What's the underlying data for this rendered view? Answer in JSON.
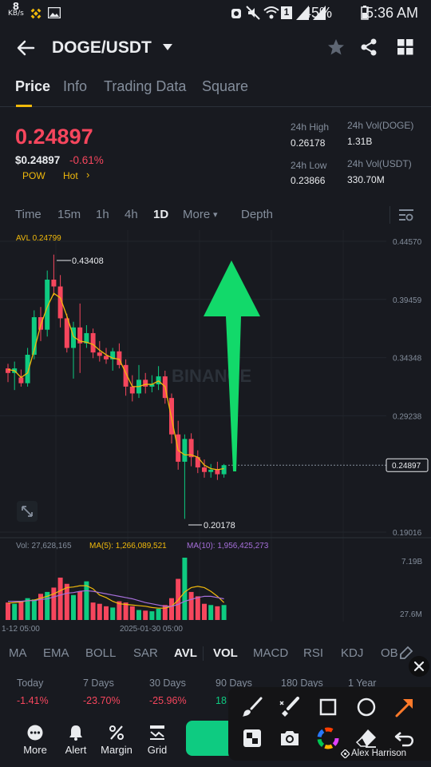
{
  "status_bar": {
    "net_speed": "8",
    "net_unit": "KB/s",
    "battery": "45%",
    "time": "5:36 AM",
    "sim_badge": "1"
  },
  "header": {
    "pair": "DOGE/USDT",
    "back_icon": "arrow-left-icon",
    "star_icon": "star-icon",
    "share_icon": "share-icon",
    "grid_icon": "grid-icon"
  },
  "tabs": [
    {
      "label": "Price",
      "active": true
    },
    {
      "label": "Info"
    },
    {
      "label": "Trading Data"
    },
    {
      "label": "Square"
    }
  ],
  "price": {
    "last": "0.24897",
    "usd": "$0.24897",
    "change": "-0.61%",
    "tag_pow": "POW",
    "tag_hot": "Hot",
    "tag_arrow": "›"
  },
  "stats": {
    "high_label": "24h High",
    "high_value": "0.26178",
    "low_label": "24h Low",
    "low_value": "0.23866",
    "vol_base_label": "24h Vol(DOGE)",
    "vol_base_value": "1.31B",
    "vol_quote_label": "24h Vol(USDT)",
    "vol_quote_value": "330.70M"
  },
  "intervals": {
    "items": [
      "Time",
      "15m",
      "1h",
      "4h",
      "1D",
      "More"
    ],
    "active": "1D",
    "more_caret": "▾",
    "depth_label": "Depth"
  },
  "chart": {
    "avl_label": "AVL 0.24799",
    "watermark": "BINANCE",
    "price_axis": [
      "0.44570",
      "0.39459",
      "0.34348",
      "0.29238",
      "0.24897",
      "0.19016"
    ],
    "max_label": "0.43408",
    "min_label": "0.20178",
    "vol_label": "Vol: 27,628,165",
    "ma5_label": "MA(5): 1,266,089,521",
    "ma10_label": "MA(10): 1,956,425,273",
    "vol_axis_top": "7.19B",
    "vol_axis_bottom": "27.6M",
    "date_left": "1-12 05:00",
    "date_center": "2025-01-30 05:00",
    "colors": {
      "up": "#0ecb81",
      "down": "#f6465d",
      "avl": "#f0b90b",
      "ma10": "#a66fda",
      "arrow": "#12d96a"
    }
  },
  "chart_data": {
    "type": "candlestick",
    "ylim": [
      0.19016,
      0.4457
    ],
    "candles": [
      {
        "o": 0.334,
        "h": 0.338,
        "l": 0.322,
        "c": 0.33
      },
      {
        "o": 0.33,
        "h": 0.34,
        "l": 0.315,
        "c": 0.334
      },
      {
        "o": 0.326,
        "h": 0.333,
        "l": 0.318,
        "c": 0.321
      },
      {
        "o": 0.321,
        "h": 0.352,
        "l": 0.318,
        "c": 0.346
      },
      {
        "o": 0.346,
        "h": 0.385,
        "l": 0.342,
        "c": 0.379
      },
      {
        "o": 0.379,
        "h": 0.388,
        "l": 0.358,
        "c": 0.368
      },
      {
        "o": 0.368,
        "h": 0.42,
        "l": 0.362,
        "c": 0.412
      },
      {
        "o": 0.412,
        "h": 0.434,
        "l": 0.398,
        "c": 0.406
      },
      {
        "o": 0.406,
        "h": 0.416,
        "l": 0.37,
        "c": 0.378
      },
      {
        "o": 0.378,
        "h": 0.382,
        "l": 0.348,
        "c": 0.352
      },
      {
        "o": 0.352,
        "h": 0.375,
        "l": 0.325,
        "c": 0.37
      },
      {
        "o": 0.37,
        "h": 0.391,
        "l": 0.33,
        "c": 0.356
      },
      {
        "o": 0.356,
        "h": 0.372,
        "l": 0.352,
        "c": 0.365
      },
      {
        "o": 0.365,
        "h": 0.369,
        "l": 0.343,
        "c": 0.348
      },
      {
        "o": 0.348,
        "h": 0.358,
        "l": 0.34,
        "c": 0.345
      },
      {
        "o": 0.345,
        "h": 0.352,
        "l": 0.338,
        "c": 0.342
      },
      {
        "o": 0.342,
        "h": 0.352,
        "l": 0.332,
        "c": 0.349
      },
      {
        "o": 0.349,
        "h": 0.356,
        "l": 0.334,
        "c": 0.337
      },
      {
        "o": 0.337,
        "h": 0.342,
        "l": 0.31,
        "c": 0.318
      },
      {
        "o": 0.318,
        "h": 0.328,
        "l": 0.305,
        "c": 0.312
      },
      {
        "o": 0.312,
        "h": 0.337,
        "l": 0.308,
        "c": 0.324
      },
      {
        "o": 0.324,
        "h": 0.33,
        "l": 0.312,
        "c": 0.318
      },
      {
        "o": 0.318,
        "h": 0.328,
        "l": 0.313,
        "c": 0.32
      },
      {
        "o": 0.32,
        "h": 0.336,
        "l": 0.315,
        "c": 0.327
      },
      {
        "o": 0.327,
        "h": 0.332,
        "l": 0.303,
        "c": 0.308
      },
      {
        "o": 0.308,
        "h": 0.312,
        "l": 0.268,
        "c": 0.276
      },
      {
        "o": 0.276,
        "h": 0.288,
        "l": 0.245,
        "c": 0.252
      },
      {
        "o": 0.252,
        "h": 0.276,
        "l": 0.2018,
        "c": 0.272
      },
      {
        "o": 0.272,
        "h": 0.277,
        "l": 0.248,
        "c": 0.256
      },
      {
        "o": 0.256,
        "h": 0.262,
        "l": 0.242,
        "c": 0.247
      },
      {
        "o": 0.247,
        "h": 0.254,
        "l": 0.238,
        "c": 0.243
      },
      {
        "o": 0.243,
        "h": 0.25,
        "l": 0.238,
        "c": 0.245
      },
      {
        "o": 0.245,
        "h": 0.252,
        "l": 0.236,
        "c": 0.241
      },
      {
        "o": 0.241,
        "h": 0.25,
        "l": 0.238,
        "c": 0.249
      }
    ],
    "avl": [
      0.333,
      0.332,
      0.326,
      0.33,
      0.35,
      0.372,
      0.388,
      0.4,
      0.396,
      0.38,
      0.362,
      0.358,
      0.357,
      0.355,
      0.35,
      0.346,
      0.343,
      0.342,
      0.33,
      0.318,
      0.318,
      0.32,
      0.32,
      0.323,
      0.318,
      0.29,
      0.262,
      0.258,
      0.258,
      0.256,
      0.249,
      0.246,
      0.245,
      0.246
    ],
    "volumes": [
      0.28,
      0.26,
      0.3,
      0.35,
      0.33,
      0.42,
      0.45,
      0.52,
      0.68,
      0.58,
      0.4,
      0.46,
      0.62,
      0.28,
      0.26,
      0.22,
      0.2,
      0.3,
      0.28,
      0.22,
      0.16,
      0.15,
      0.14,
      0.18,
      0.24,
      0.35,
      0.66,
      1.0,
      0.45,
      0.38,
      0.26,
      0.24,
      0.22,
      0.24
    ],
    "ma5_vol": [
      0.27,
      0.28,
      0.29,
      0.31,
      0.32,
      0.35,
      0.38,
      0.42,
      0.47,
      0.52,
      0.53,
      0.55,
      0.55,
      0.5,
      0.4,
      0.36,
      0.3,
      0.26,
      0.25,
      0.24,
      0.23,
      0.22,
      0.2,
      0.19,
      0.19,
      0.22,
      0.32,
      0.45,
      0.52,
      0.54,
      0.52,
      0.46,
      0.38,
      0.28
    ],
    "ma10_vol": [
      0.3,
      0.3,
      0.3,
      0.31,
      0.31,
      0.33,
      0.34,
      0.37,
      0.4,
      0.43,
      0.44,
      0.46,
      0.47,
      0.46,
      0.44,
      0.42,
      0.4,
      0.38,
      0.36,
      0.34,
      0.31,
      0.28,
      0.26,
      0.24,
      0.22,
      0.22,
      0.25,
      0.3,
      0.33,
      0.36,
      0.38,
      0.38,
      0.36,
      0.34
    ],
    "current_price": 0.24897
  },
  "indicators": {
    "items": [
      "MA",
      "EMA",
      "BOLL",
      "SAR",
      "AVL",
      "VOL",
      "MACD",
      "RSI",
      "KDJ",
      "OB"
    ],
    "active": [
      "AVL",
      "VOL"
    ]
  },
  "performance": [
    {
      "label": "Today",
      "value": "-1.41%"
    },
    {
      "label": "7 Days",
      "value": "-23.70%"
    },
    {
      "label": "30 Days",
      "value": "-25.96%"
    },
    {
      "label": "90 Days",
      "value": "18"
    },
    {
      "label": "180 Days",
      "value": ""
    },
    {
      "label": "1 Year",
      "value": ""
    }
  ],
  "bottom_nav": [
    {
      "label": "More",
      "icon": "more-dots-icon"
    },
    {
      "label": "Alert",
      "icon": "bell-icon"
    },
    {
      "label": "Margin",
      "icon": "percent-icon"
    },
    {
      "label": "Grid",
      "icon": "grid-bot-icon"
    }
  ],
  "draw_tools": {
    "row1": [
      "brush-icon",
      "highlighter-icon",
      "square-icon",
      "circle-icon",
      "arrow-icon"
    ],
    "row2": [
      "mosaic-icon",
      "camera-icon",
      "color-wheel-icon",
      "eraser-icon",
      "undo-icon"
    ],
    "credit": "Alex Harrison",
    "close_icon": "close-icon"
  }
}
